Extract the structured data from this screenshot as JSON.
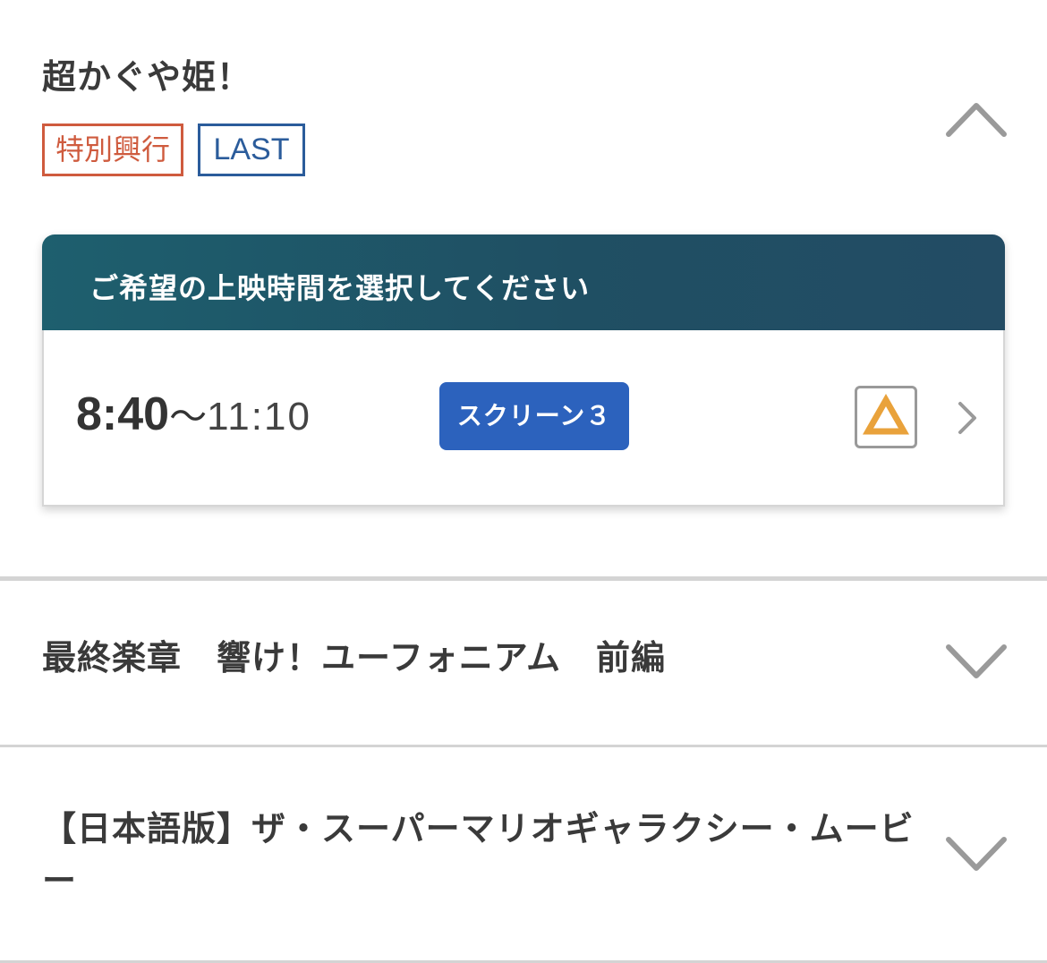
{
  "movies": [
    {
      "title": "超かぐや姫！",
      "expanded": true,
      "tags": {
        "special": "特別興行",
        "last": "LAST"
      },
      "panel": {
        "header": "ご希望の上映時間を選択してください",
        "showtimes": [
          {
            "start": "8:40",
            "separator": "〜",
            "end": "11:10",
            "screen": "スクリーン３",
            "availability": "△"
          }
        ]
      },
      "toggle_icon": "chevron-up-icon"
    },
    {
      "title": "最終楽章　響け！ユーフォニアム　前編",
      "expanded": false,
      "toggle_icon": "chevron-down-icon"
    },
    {
      "title": "【日本語版】ザ・スーパーマリオギャラクシー・ムービー",
      "expanded": false,
      "toggle_icon": "chevron-down-icon"
    }
  ],
  "colors": {
    "tag_special": "#cf5b3e",
    "tag_last": "#2b5c9b",
    "panel_header": "#1f4f63",
    "screen_badge": "#2c62bd",
    "availability_triangle": "#e9a23b"
  }
}
